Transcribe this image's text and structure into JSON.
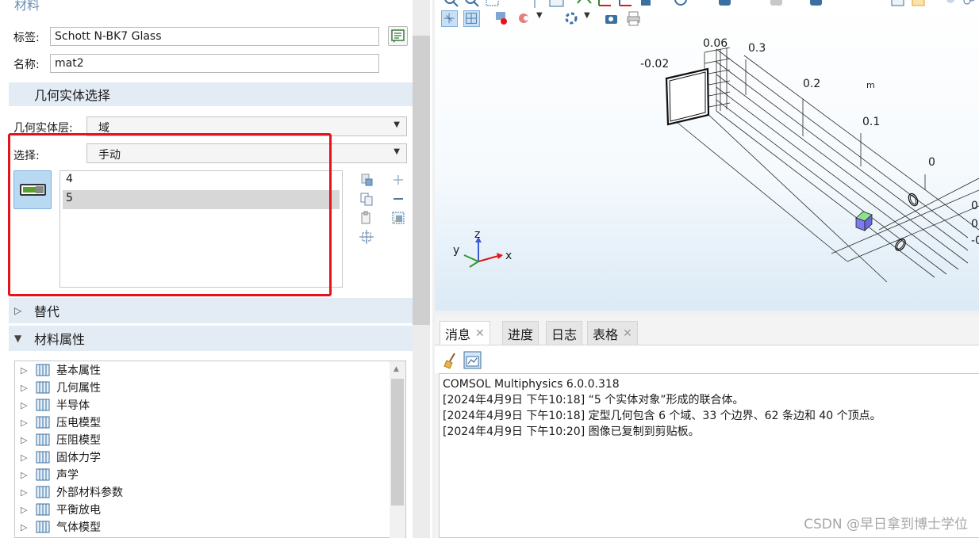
{
  "settings": {
    "section_title": "材料",
    "label_caption": "标签:",
    "label_value": "Schott N-BK7 Glass",
    "name_caption": "名称:",
    "name_value": "mat2",
    "geometry_header": "几何实体选择",
    "geom_level_caption": "几何实体层:",
    "geom_level_value": "域",
    "selection_caption": "选择:",
    "selection_value": "手动",
    "selection_items": [
      "4",
      "5"
    ],
    "override_header": "替代",
    "props_header": "材料属性",
    "tree_items": [
      "基本属性",
      "几何属性",
      "半导体",
      "压电模型",
      "压阻模型",
      "固体力学",
      "声学",
      "外部材料参数",
      "平衡放电",
      "气体模型"
    ]
  },
  "graphics": {
    "axis_labels": {
      "n002": "-0.02",
      "p006": "0.06",
      "p03": "0.3",
      "p02": "0.2",
      "unit": "m",
      "p01": "0.1",
      "zero": "0",
      "r1": "0",
      "r2": "0",
      "r3": "-0"
    },
    "triad": {
      "x": "x",
      "y": "y",
      "z": "z"
    },
    "accent_color": "#e3141c"
  },
  "messages": {
    "tabs": [
      {
        "label": "消息",
        "closable": true,
        "active": true
      },
      {
        "label": "进度",
        "closable": false,
        "active": false
      },
      {
        "label": "日志",
        "closable": false,
        "active": false
      },
      {
        "label": "表格",
        "closable": true,
        "active": false
      }
    ],
    "lines": [
      "COMSOL Multiphysics 6.0.0.318",
      "[2024年4月9日 下午10:18] “5 个实体对象”形成的联合体。",
      "[2024年4月9日 下午10:18] 定型几何包含 6 个域、33 个边界、62 条边和 40 个顶点。",
      "[2024年4月9日 下午10:20] 图像已复制到剪贴板。"
    ]
  },
  "watermark": "CSDN @早日拿到博士学位"
}
